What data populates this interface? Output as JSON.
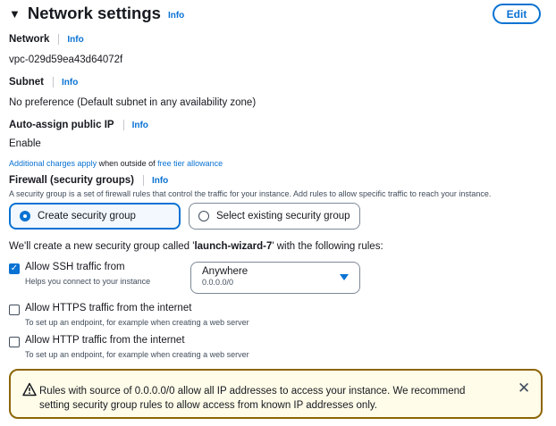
{
  "header": {
    "title": "Network settings",
    "info": "Info",
    "edit": "Edit"
  },
  "network": {
    "label": "Network",
    "info": "Info",
    "value": "vpc-029d59ea43d64072f"
  },
  "subnet": {
    "label": "Subnet",
    "info": "Info",
    "value": "No preference (Default subnet in any availability zone)"
  },
  "public_ip": {
    "label": "Auto-assign public IP",
    "info": "Info",
    "value": "Enable",
    "note_link1": "Additional charges apply",
    "note_mid": " when outside of ",
    "note_link2": "free tier allowance"
  },
  "firewall": {
    "label": "Firewall (security groups)",
    "info": "Info",
    "description": "A security group is a set of firewall rules that control the traffic for your instance. Add rules to allow specific traffic to reach your instance.",
    "create_label": "Create security group",
    "existing_label": "Select existing security group",
    "create_pre": "We'll create a new security group called '",
    "group_name": "launch-wizard-7",
    "create_post": "' with the following rules:"
  },
  "rules": [
    {
      "title": "Allow SSH traffic from",
      "desc": "Helps you connect to your instance",
      "checked": true
    },
    {
      "title": "Allow HTTPS traffic from the internet",
      "desc": "To set up an endpoint, for example when creating a web server",
      "checked": false
    },
    {
      "title": "Allow HTTP traffic from the internet",
      "desc": "To set up an endpoint, for example when creating a web server",
      "checked": false
    }
  ],
  "ssh_source": {
    "value": "Anywhere",
    "sub": "0.0.0.0/0"
  },
  "alert": {
    "text": "Rules with source of 0.0.0.0/0 allow all IP addresses to access your instance. We recommend setting security group rules to allow access from known IP addresses only.",
    "icon": "warning-icon"
  },
  "colors": {
    "accent": "#0972d3",
    "warning_border": "#8d6605",
    "warning_bg": "#fffce9"
  }
}
